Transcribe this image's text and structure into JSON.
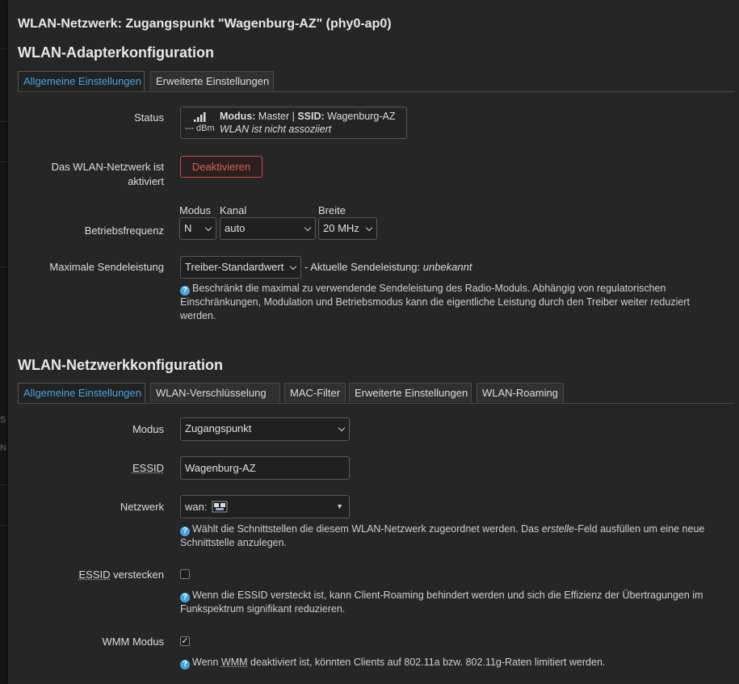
{
  "dialog_title": "WLAN-Netzwerk: Zugangspunkt \"Wagenburg-AZ\" (phy0-ap0)",
  "background": {
    "fragment_1": "S",
    "fragment_2": "N"
  },
  "adapter": {
    "heading": "WLAN-Adapterkonfiguration",
    "tabs": [
      "Allgemeine Einstellungen",
      "Erweiterte Einstellungen"
    ],
    "status": {
      "label": "Status",
      "mode_key": "Modus:",
      "mode_value": "Master",
      "separator": "|",
      "ssid_key": "SSID:",
      "ssid_value": "Wagenburg-AZ",
      "signal": "--- dBm",
      "assoc_text": "WLAN ist nicht assoziiert"
    },
    "enabled": {
      "label": "Das WLAN-Netzwerk ist aktiviert",
      "button": "Deaktivieren"
    },
    "frequency": {
      "label": "Betriebsfrequenz",
      "mode_label": "Modus",
      "mode_value": "N",
      "channel_label": "Kanal",
      "channel_value": "auto",
      "width_label": "Breite",
      "width_value": "20 MHz"
    },
    "txpower": {
      "label": "Maximale Sendeleistung",
      "value": "Treiber-Standardwert",
      "current_prefix": "- Aktuelle Sendeleistung:",
      "current_value": "unbekannt",
      "help": "Beschränkt die maximal zu verwendende Sendeleistung des Radio-Moduls. Abhängig von regulatorischen Einschränkungen, Modulation und Betriebsmodus kann die eigentliche Leistung durch den Treiber weiter reduziert werden."
    }
  },
  "network": {
    "heading": "WLAN-Netzwerkkonfiguration",
    "tabs": [
      "Allgemeine Einstellungen",
      "WLAN-Verschlüsselung",
      "MAC-Filter",
      "Erweiterte Einstellungen",
      "WLAN-Roaming"
    ],
    "mode": {
      "label": "Modus",
      "value": "Zugangspunkt"
    },
    "essid": {
      "label": "ESSID",
      "value": "Wagenburg-AZ"
    },
    "net": {
      "label": "Netzwerk",
      "value": "wan:",
      "help_a": "Wählt die Schnittstellen die diesem WLAN-Netzwerk zugeordnet werden. Das ",
      "help_em": "erstelle",
      "help_b": "-Feld ausfüllen um eine neue Schnittstelle anzulegen."
    },
    "hidden": {
      "label_abbr": "ESSID",
      "label_rest": "verstecken",
      "help": "Wenn die ESSID versteckt ist, kann Client-Roaming behindert werden und sich die Effizienz der Übertragungen im Funkspektrum signifikant reduzieren."
    },
    "wmm": {
      "label": "WMM Modus",
      "help_a": "Wenn ",
      "help_abbr": "WMM",
      "help_b": " deaktiviert ist, könnten Clients auf 802.11a bzw. 802.11g-Raten limitiert werden."
    }
  },
  "colors": {
    "accent": "#4aa3df",
    "danger": "#e05d5a",
    "background": "#262626"
  }
}
